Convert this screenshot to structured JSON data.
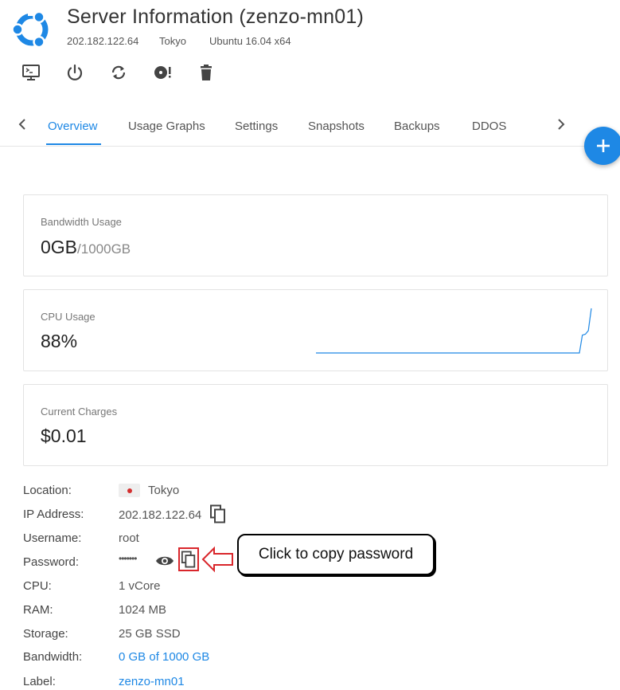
{
  "header": {
    "title": "Server Information (zenzo-mn01)",
    "ip": "202.182.122.64",
    "location": "Tokyo",
    "os": "Ubuntu 16.04 x64"
  },
  "toolbar": {
    "icons": [
      "console-icon",
      "power-icon",
      "restart-icon",
      "reinstall-icon",
      "trash-icon"
    ]
  },
  "tabs": [
    {
      "label": "Overview",
      "active": true
    },
    {
      "label": "Usage Graphs"
    },
    {
      "label": "Settings"
    },
    {
      "label": "Snapshots"
    },
    {
      "label": "Backups"
    },
    {
      "label": "DDOS"
    }
  ],
  "fab": {
    "label": "+"
  },
  "cards": {
    "bandwidth": {
      "label": "Bandwidth Usage",
      "value": "0GB",
      "sub": "/1000GB"
    },
    "cpu": {
      "label": "CPU Usage",
      "value": "88%",
      "sparkline": [
        0,
        0,
        0,
        0,
        0,
        0,
        0,
        0,
        0,
        0,
        0,
        0,
        0,
        0,
        0,
        0,
        0,
        0,
        0,
        0,
        0,
        0,
        0,
        0,
        0,
        0,
        0,
        0,
        0,
        0,
        0,
        0,
        0,
        0,
        0,
        0,
        0,
        0,
        0,
        0,
        0,
        0,
        0,
        0,
        0,
        0,
        0,
        0,
        0,
        0,
        0,
        0,
        0,
        0,
        0,
        0,
        0,
        0,
        0,
        0,
        0,
        0,
        0,
        0,
        0,
        0,
        0,
        0,
        0,
        0,
        0,
        0,
        0,
        0,
        0,
        0,
        0,
        0,
        0,
        0,
        0,
        0,
        0,
        0,
        0,
        0,
        0,
        0,
        0,
        40,
        42,
        50,
        100
      ]
    },
    "charges": {
      "label": "Current Charges",
      "value": "$0.01"
    }
  },
  "details": {
    "location": {
      "label": "Location:",
      "value": "Tokyo"
    },
    "ip": {
      "label": "IP Address:",
      "value": "202.182.122.64"
    },
    "username": {
      "label": "Username:",
      "value": "root"
    },
    "password": {
      "label": "Password:",
      "value": "•••••••"
    },
    "cpu": {
      "label": "CPU:",
      "value": "1 vCore"
    },
    "ram": {
      "label": "RAM:",
      "value": "1024 MB"
    },
    "storage": {
      "label": "Storage:",
      "value": "25 GB SSD"
    },
    "bandwidth": {
      "label": "Bandwidth:",
      "value": "0 GB of 1000 GB"
    },
    "label": {
      "label": "Label:",
      "value": "zenzo-mn01"
    }
  },
  "annotation": {
    "text": "Click to copy password"
  },
  "colors": {
    "accent": "#1e88e5",
    "highlight": "#d9262b"
  }
}
